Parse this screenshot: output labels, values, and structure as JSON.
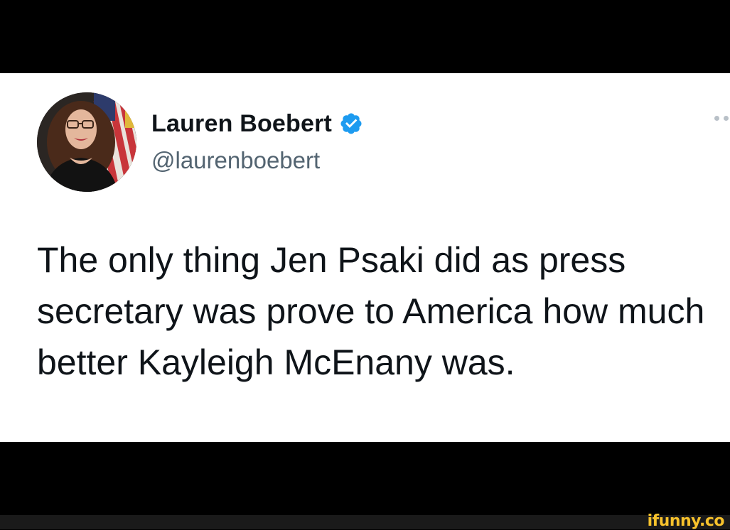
{
  "tweet": {
    "display_name": "Lauren Boebert",
    "handle": "@laurenboebert",
    "verified": true,
    "text": "The only thing Jen Psaki did as press secretary was prove to America how much better Kayleigh McEnany was.",
    "avatar_icon": "profile-photo",
    "more_icon": "more-options-icon"
  },
  "watermark": {
    "text": "ifunny.co"
  },
  "colors": {
    "verified": "#1d9bf0",
    "name": "#0f1419",
    "handle": "#536471",
    "watermark": "#f7c22c",
    "background": "#000000",
    "card": "#ffffff"
  }
}
